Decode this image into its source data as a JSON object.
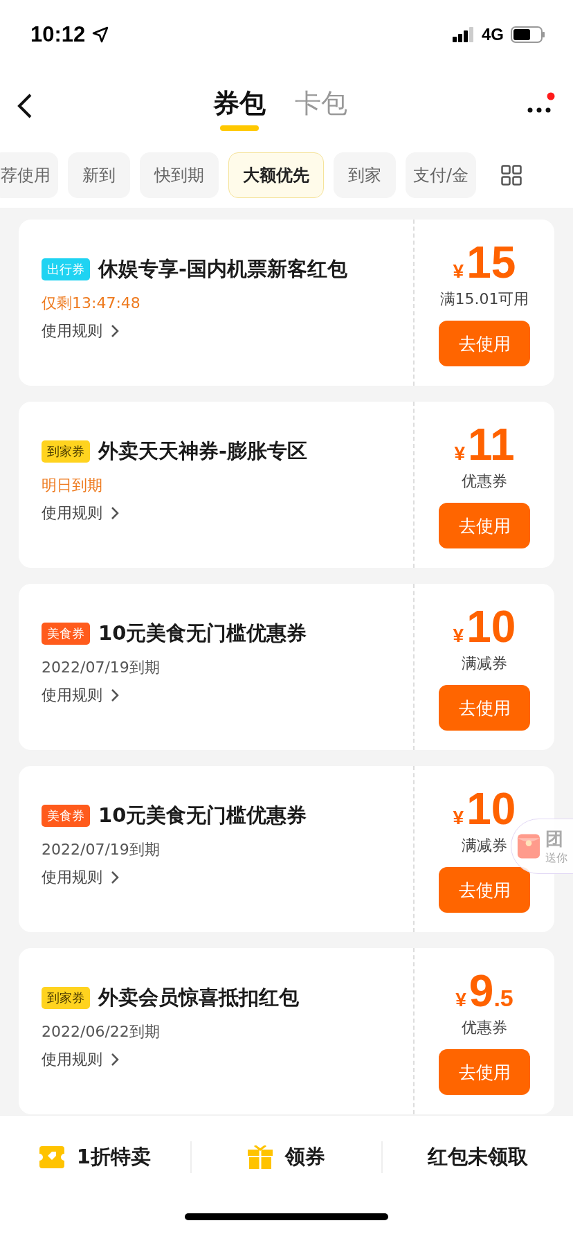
{
  "status_bar": {
    "time": "10:12",
    "network": "4G"
  },
  "nav": {
    "tabs": [
      {
        "label": "券包",
        "selected": true
      },
      {
        "label": "卡包",
        "selected": false
      }
    ],
    "has_notification": true
  },
  "filters": [
    {
      "label": "荐使用",
      "selected": false
    },
    {
      "label": "新到",
      "selected": false
    },
    {
      "label": "快到期",
      "selected": false
    },
    {
      "label": "大额优先",
      "selected": true
    },
    {
      "label": "到家",
      "selected": false
    },
    {
      "label": "支付/金",
      "selected": false
    }
  ],
  "coupons": [
    {
      "tag": {
        "text": "出行券",
        "color": "#1fd3f2"
      },
      "title": "休娱专享-国内机票新客红包",
      "expiry": "仅剩13:47:48",
      "urgent": true,
      "rules": "使用规则",
      "currency": "¥",
      "amount": "15",
      "condition": "满15.01可用",
      "button": "去使用"
    },
    {
      "tag": {
        "text": "到家券",
        "color": "#ffd31f"
      },
      "title": "外卖天天神券-膨胀专区",
      "expiry": "明日到期",
      "urgent": true,
      "rules": "使用规则",
      "currency": "¥",
      "amount": "11",
      "condition": "优惠券",
      "button": "去使用"
    },
    {
      "tag": {
        "text": "美食券",
        "color": "#ff5b1c"
      },
      "title": "10元美食无门槛优惠券",
      "expiry": "2022/07/19到期",
      "urgent": false,
      "rules": "使用规则",
      "currency": "¥",
      "amount": "10",
      "condition": "满减券",
      "button": "去使用"
    },
    {
      "tag": {
        "text": "美食券",
        "color": "#ff5b1c"
      },
      "title": "10元美食无门槛优惠券",
      "expiry": "2022/07/19到期",
      "urgent": false,
      "rules": "使用规则",
      "currency": "¥",
      "amount": "10",
      "condition": "满减券",
      "button": "去使用"
    },
    {
      "tag": {
        "text": "到家券",
        "color": "#ffd31f"
      },
      "title": "外卖会员惊喜抵扣红包",
      "expiry": "2022/06/22到期",
      "urgent": false,
      "rules": "使用规则",
      "currency": "¥",
      "amount": "9",
      "amount_decimal": ".5",
      "condition": "优惠券",
      "button": "去使用"
    }
  ],
  "floating_promo": {
    "title": "团",
    "subtitle": "送你"
  },
  "bottom_bar": [
    {
      "kind": "ticket",
      "label": "1折特卖"
    },
    {
      "kind": "gift",
      "label": "领券"
    },
    {
      "kind": "text",
      "label": "红包未领取"
    }
  ]
}
